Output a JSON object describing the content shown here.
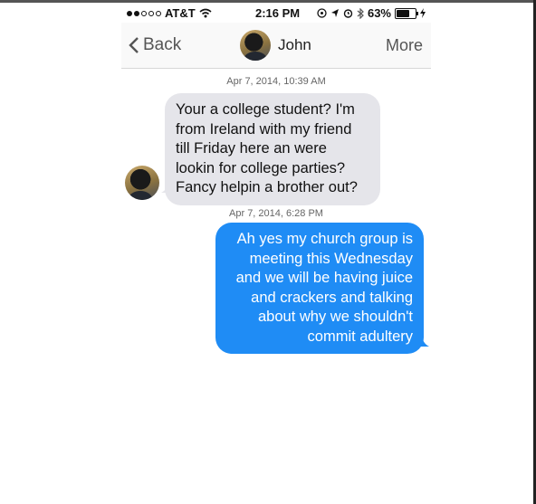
{
  "status_bar": {
    "carrier": "AT&T",
    "time": "2:16 PM",
    "battery": "63%",
    "battery_level": 0.63
  },
  "nav": {
    "back_label": "Back",
    "contact_name": "John",
    "more_label": "More"
  },
  "messages": [
    {
      "timestamp": "Apr 7, 2014, 10:39 AM",
      "direction": "incoming",
      "lines": [
        "Your a college student? I'm",
        "from Ireland with my friend",
        "till Friday here an were",
        "lookin for college parties?",
        "Fancy helpin a brother out?"
      ]
    },
    {
      "timestamp": "Apr 7, 2014, 6:28 PM",
      "direction": "outgoing",
      "lines": [
        "Ah yes my church group is",
        "meeting this Wednesday",
        "and we will be having juice",
        "and crackers and talking",
        "about why we shouldn't",
        "commit adultery"
      ]
    }
  ],
  "colors": {
    "incoming_bubble": "#e5e5ea",
    "outgoing_bubble": "#1f8cf5",
    "accent": "#555555"
  },
  "icons": [
    "signal-dots-icon",
    "wifi-icon",
    "location-icon",
    "alarm-icon",
    "bluetooth-icon",
    "battery-icon",
    "charging-icon",
    "back-chevron-icon"
  ]
}
